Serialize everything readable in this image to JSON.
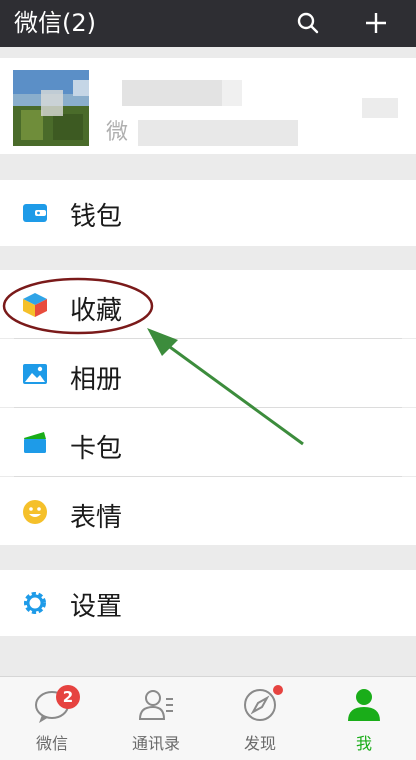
{
  "header": {
    "title": "微信(2)",
    "search_icon": "search-icon",
    "add_icon": "plus-icon"
  },
  "profile": {
    "subtitle": "微"
  },
  "menu": {
    "wallet": "钱包",
    "favorites": "收藏",
    "album": "相册",
    "cards": "卡包",
    "stickers": "表情",
    "settings": "设置"
  },
  "tabs": [
    {
      "label": "微信",
      "icon": "chat-icon",
      "badge": "2"
    },
    {
      "label": "通讯录",
      "icon": "contacts-icon"
    },
    {
      "label": "发现",
      "icon": "compass-icon"
    },
    {
      "label": "我",
      "icon": "person-icon"
    }
  ],
  "colors": {
    "accent_green": "#1aad19",
    "badge_red": "#e64340",
    "header_bg": "#2e2e33",
    "annotation_circle": "#7a1a1a",
    "annotation_arrow": "#3c8c3c"
  }
}
